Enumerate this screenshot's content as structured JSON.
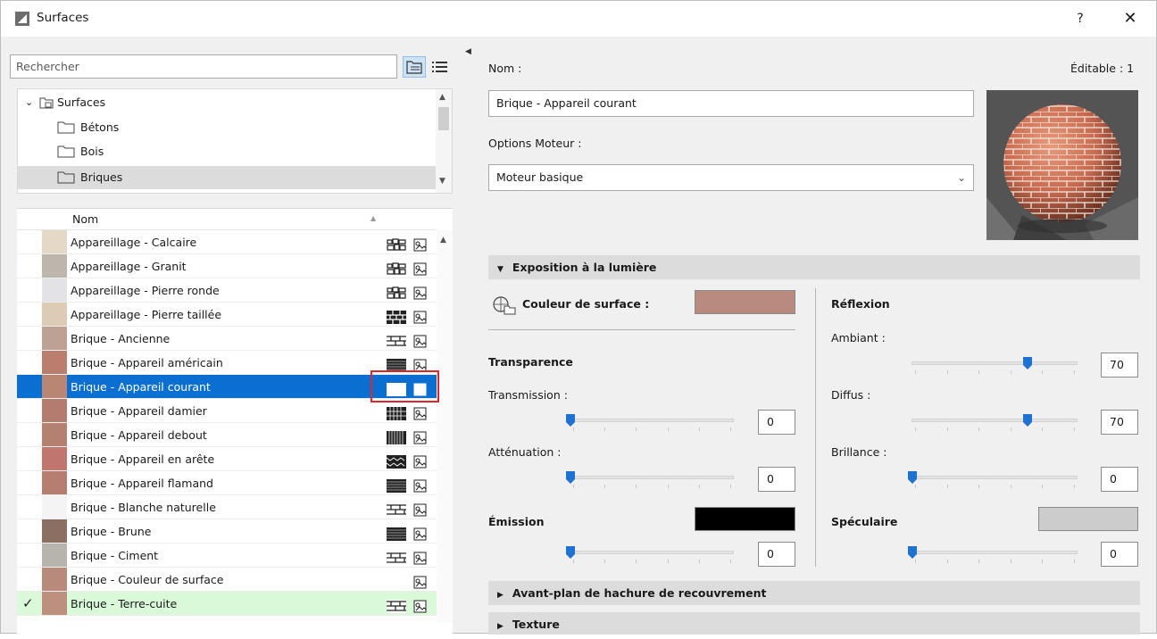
{
  "window": {
    "title": "Surfaces",
    "help": "?",
    "close": "✕"
  },
  "left": {
    "search_placeholder": "Rechercher",
    "tree": [
      {
        "label": "Surfaces",
        "type": "root"
      },
      {
        "label": "Bétons",
        "type": "folder"
      },
      {
        "label": "Bois",
        "type": "folder"
      },
      {
        "label": "Briques",
        "type": "folder",
        "selected": true
      }
    ],
    "list_header": "Nom",
    "rows": [
      {
        "name": "Appareillage - Calcaire",
        "color": "#e6d8c6",
        "hatch": "stone"
      },
      {
        "name": "Appareillage - Granit",
        "color": "#bcb6ad",
        "hatch": "stone"
      },
      {
        "name": "Appareillage - Pierre ronde",
        "color": "#e3e3e6",
        "hatch": "stone"
      },
      {
        "name": "Appareillage - Pierre taillée",
        "color": "#dccbb5",
        "hatch": "block"
      },
      {
        "name": "Brique - Ancienne",
        "color": "#bda194",
        "hatch": "brick"
      },
      {
        "name": "Brique - Appareil américain",
        "color": "#b97e6e",
        "hatch": "dense"
      },
      {
        "name": "Brique - Appareil courant",
        "color": "#b98674",
        "hatch": "brick",
        "selected": true
      },
      {
        "name": "Brique - Appareil damier",
        "color": "#b47c6e",
        "hatch": "grid"
      },
      {
        "name": "Brique - Appareil debout",
        "color": "#b48070",
        "hatch": "vertical"
      },
      {
        "name": "Brique - Appareil en arête",
        "color": "#c0766c",
        "hatch": "herring"
      },
      {
        "name": "Brique - Appareil flamand",
        "color": "#b67e70",
        "hatch": "dense"
      },
      {
        "name": "Brique - Blanche naturelle",
        "color": "#f4f4f4",
        "hatch": "brick"
      },
      {
        "name": "Brique - Brune",
        "color": "#8b6f62",
        "hatch": "dense"
      },
      {
        "name": "Brique - Ciment",
        "color": "#b7b3ad",
        "hatch": "brick"
      },
      {
        "name": "Brique - Couleur de surface",
        "color": "#b78a7c",
        "hatch": "none"
      },
      {
        "name": "Brique - Terre-cuite",
        "color": "#bd907e",
        "hatch": "brick",
        "current": true,
        "check": "✓"
      }
    ]
  },
  "right": {
    "name_label": "Nom :",
    "editable": "Éditable : 1",
    "name_value": "Brique - Appareil courant",
    "engine_label": "Options Moteur :",
    "engine_value": "Moteur basique",
    "section_light": "Exposition à la lumière",
    "surface_color_label": "Couleur de surface :",
    "surface_color": "#b98b7e",
    "transparency": "Transparence",
    "transmission": "Transmission :",
    "transmission_value": "0",
    "attenuation": "Atténuation :",
    "attenuation_value": "0",
    "emission": "Émission",
    "emission_color": "#000000",
    "emission_value": "0",
    "reflection": "Réflexion",
    "ambient": "Ambiant :",
    "ambient_value": "70",
    "diffuse": "Diffus :",
    "diffuse_value": "70",
    "shininess": "Brillance :",
    "shininess_value": "0",
    "specular": "Spéculaire",
    "specular_color": "#cccccc",
    "specular_value": "0",
    "section_hatch": "Avant-plan de hachure de recouvrement",
    "section_texture": "Texture"
  }
}
